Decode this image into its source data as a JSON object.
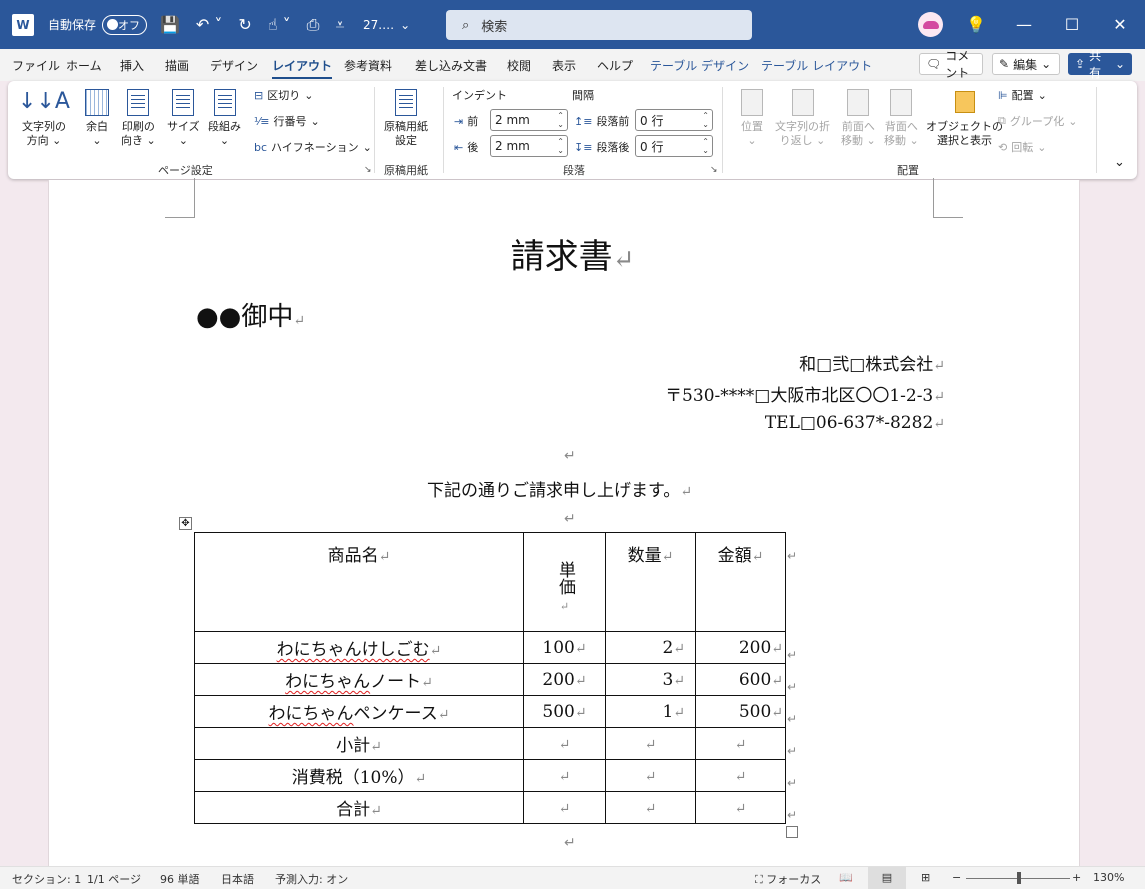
{
  "titlebar": {
    "app_icon": "W",
    "autosave_label": "自動保存",
    "autosave_state": "オフ",
    "doc_title": "27.…",
    "search_placeholder": "検索",
    "minimize_icon": "—",
    "maximize_icon": "☐",
    "close_icon": "✕"
  },
  "tabs": [
    "ファイル",
    "ホーム",
    "挿入",
    "描画",
    "デザイン",
    "レイアウト",
    "参考資料",
    "差し込み文書",
    "校閲",
    "表示",
    "ヘルプ",
    "テーブル デザイン",
    "テーブル レイアウト"
  ],
  "tab_buttons": {
    "comment": "コメント",
    "edit": "編集",
    "share": "共有"
  },
  "ribbon": {
    "page_setup": {
      "text_dir": [
        "文字列の",
        "方向"
      ],
      "margins": [
        "余白",
        ""
      ],
      "orientation": [
        "印刷の",
        "向き"
      ],
      "size": [
        "サイズ",
        ""
      ],
      "columns": [
        "段組み",
        ""
      ],
      "breaks": "区切り",
      "line_numbers": "行番号",
      "hyphenation": "ハイフネーション",
      "label": "ページ設定"
    },
    "genko": {
      "button": [
        "原稿用紙",
        "設定"
      ],
      "label": "原稿用紙"
    },
    "paragraph": {
      "indent_label": "インデント",
      "spacing_label": "間隔",
      "indent_before_label": "前",
      "indent_after_label": "後",
      "indent_before": "2 mm",
      "indent_after": "2 mm",
      "space_before_label": "段落前",
      "space_after_label": "段落後",
      "space_before": "0 行",
      "space_after": "0 行",
      "label": "段落"
    },
    "arrange": {
      "position": [
        "位置",
        ""
      ],
      "wrap": [
        "文字列の折",
        "り返し"
      ],
      "forward": [
        "前面へ",
        "移動"
      ],
      "backward": [
        "背面へ",
        "移動"
      ],
      "selection_pane": [
        "オブジェクトの",
        "選択と表示"
      ],
      "align": "配置",
      "group": "グループ化",
      "rotate": "回転",
      "label": "配置"
    }
  },
  "document": {
    "title": "請求書",
    "recipient": "●●御中",
    "company": "和□弐□株式会社",
    "address": "〒530-****□大阪市北区〇〇1-2-3",
    "tel": "TEL□06-637*-8282",
    "intro": "下記の通りご請求申し上げます。",
    "table": {
      "headers": [
        "商品名",
        "単価",
        "数量",
        "金額"
      ],
      "rows": [
        {
          "name": "わにちゃんけしごむ",
          "wavy": "わにちゃんけしごむ",
          "rest": "",
          "price": "100",
          "qty": "2",
          "amount": "200"
        },
        {
          "name": "わにちゃんノート",
          "wavy": "わにちゃん",
          "rest": "ノート",
          "price": "200",
          "qty": "3",
          "amount": "600"
        },
        {
          "name": "わにちゃんペンケース",
          "wavy": "わにちゃん",
          "rest": "ペンケース",
          "price": "500",
          "qty": "1",
          "amount": "500"
        }
      ],
      "summary": [
        "小計",
        "消費税（10%）",
        "合計"
      ]
    },
    "para_mark": "↵"
  },
  "statusbar": {
    "section": "セクション: 1",
    "page": "1/1 ページ",
    "words": "96 単語",
    "language": "日本語",
    "predictive": "予測入力: オン",
    "focus": "フォーカス",
    "zoom": "130%"
  }
}
